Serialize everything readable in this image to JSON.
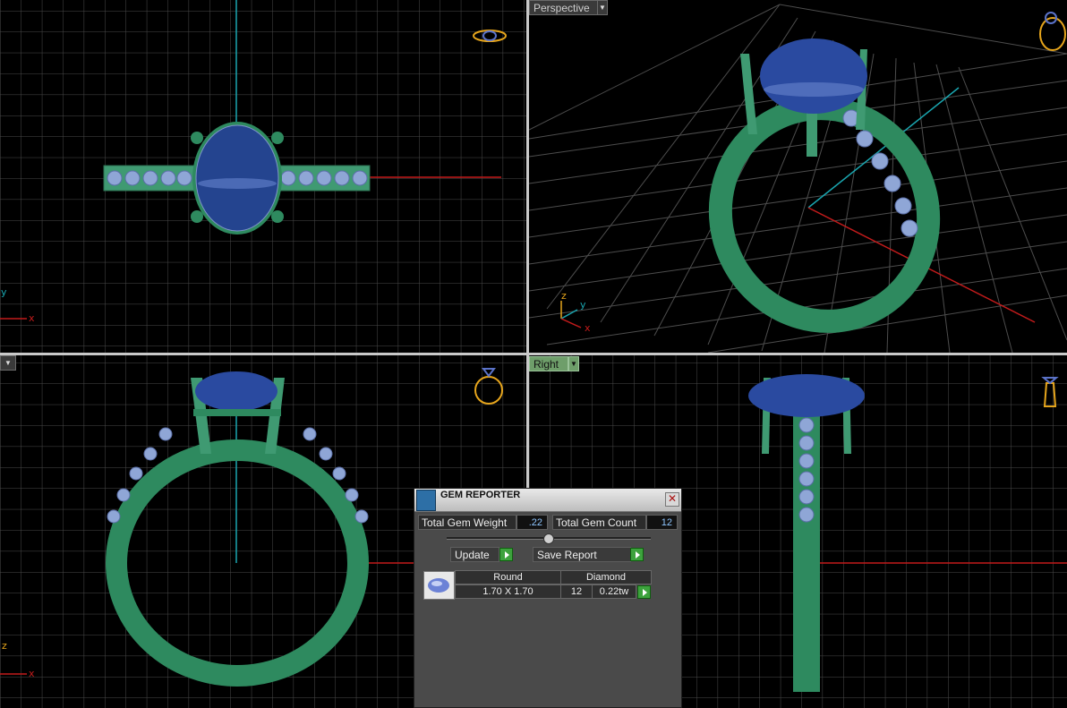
{
  "viewports": {
    "perspective_label": "Perspective",
    "right_label": "Right",
    "axis": {
      "x": "x",
      "y": "y",
      "z": "z"
    }
  },
  "gem_reporter": {
    "title": "GEM REPORTER",
    "total_weight_label": "Total Gem Weight",
    "total_weight_value": ".22",
    "total_count_label": "Total Gem Count",
    "total_count_value": "12",
    "update_label": "Update",
    "save_report_label": "Save Report",
    "row": {
      "shape": "Round",
      "material": "Diamond",
      "size": "1.70 X 1.70",
      "count": "12",
      "weight": "0.22tw"
    }
  },
  "colors": {
    "grid": "#4a4a4a",
    "x_axis": "#c21b1b",
    "y_axis": "#1aa6b0",
    "metal": "#2e8a5f",
    "stone": "#2e4fa3",
    "accent_gold": "#e6a51c"
  }
}
